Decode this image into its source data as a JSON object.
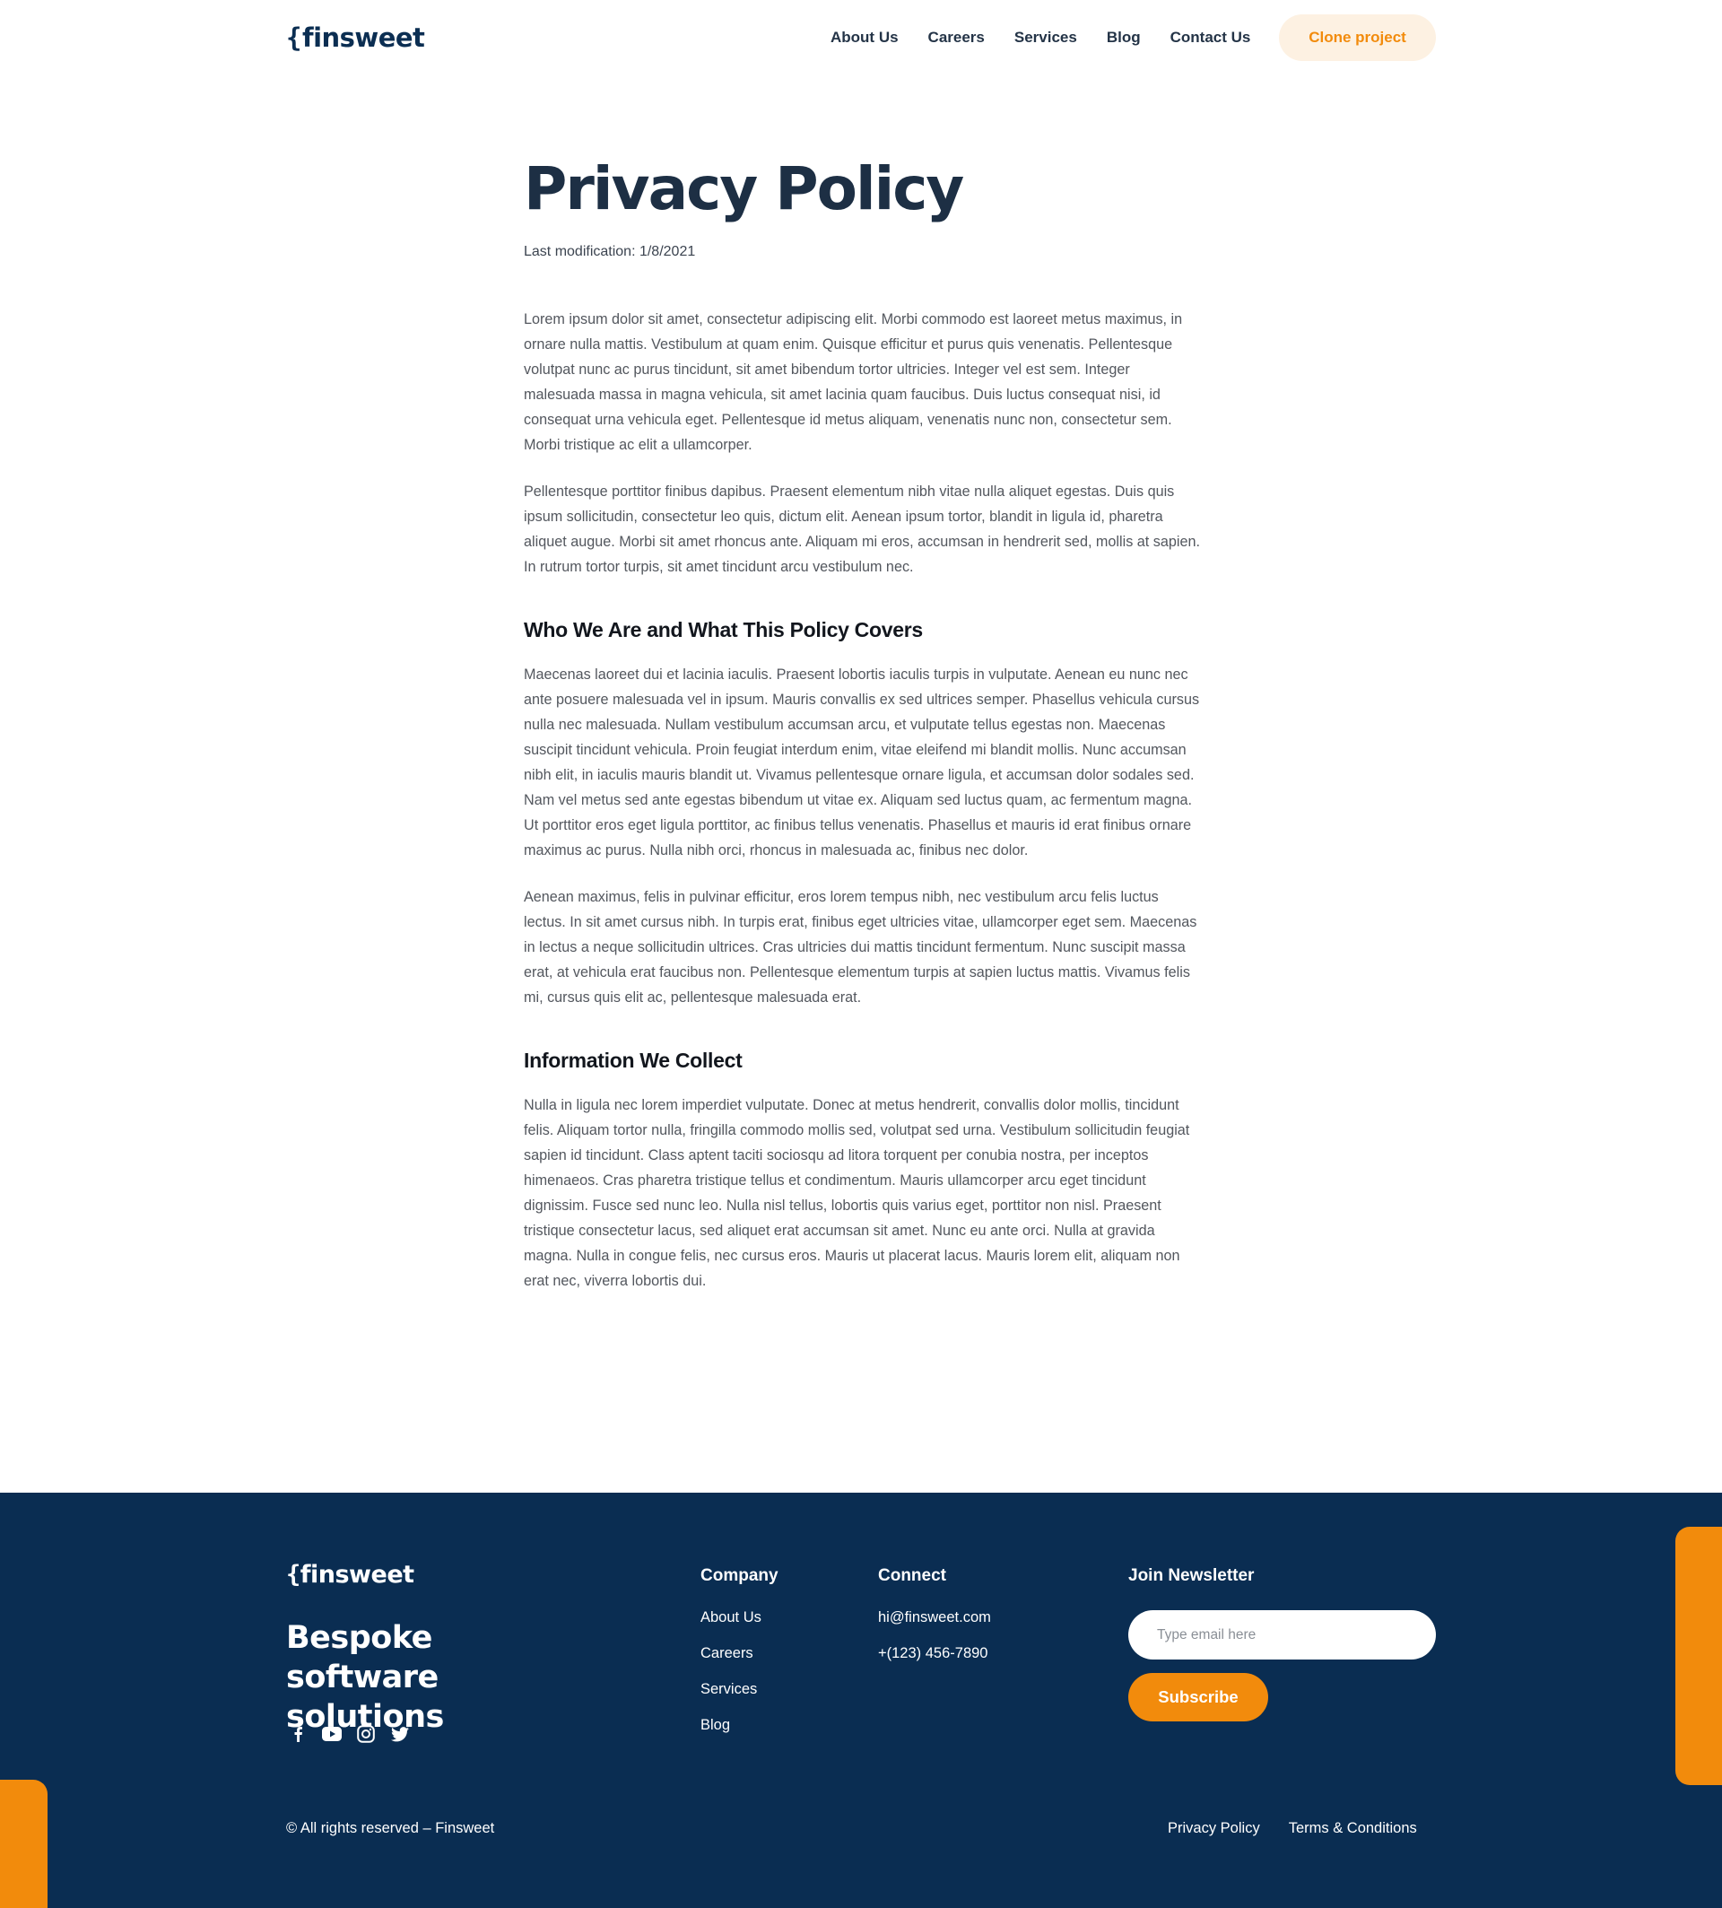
{
  "nav": {
    "logo_brace": "{",
    "logo_text": "finsweet",
    "links": [
      "About Us",
      "Careers",
      "Services",
      "Blog",
      "Contact Us"
    ],
    "cta_label": "Clone project"
  },
  "content": {
    "title": "Privacy Policy",
    "last_modification": "Last modification: 1/8/2021",
    "paragraph_1": "Lorem ipsum dolor sit amet, consectetur adipiscing elit. Morbi commodo est laoreet metus maximus, in ornare nulla mattis. Vestibulum at quam enim. Quisque efficitur et purus quis venenatis. Pellentesque volutpat nunc ac purus tincidunt, sit amet bibendum tortor ultricies. Integer vel est sem. Integer malesuada massa in magna vehicula, sit amet lacinia quam faucibus. Duis luctus consequat nisi, id consequat urna vehicula eget. Pellentesque id metus aliquam, venenatis nunc non, consectetur sem. Morbi tristique ac elit a ullamcorper.",
    "paragraph_2": "Pellentesque porttitor finibus dapibus. Praesent elementum nibh vitae nulla aliquet egestas. Duis quis ipsum sollicitudin, consectetur leo quis, dictum elit. Aenean ipsum tortor, blandit in ligula id, pharetra aliquet augue. Morbi sit amet rhoncus ante. Aliquam mi eros, accumsan in hendrerit sed, mollis at sapien. In rutrum tortor turpis, sit amet tincidunt arcu vestibulum nec.",
    "section_1_heading": "Who We Are and What This Policy Covers",
    "section_1_paragraph_1": "Maecenas laoreet dui et lacinia iaculis. Praesent lobortis iaculis turpis in vulputate. Aenean eu nunc nec ante posuere malesuada vel in ipsum. Mauris convallis ex sed ultrices semper. Phasellus vehicula cursus nulla nec malesuada. Nullam vestibulum accumsan arcu, et vulputate tellus egestas non. Maecenas suscipit tincidunt vehicula. Proin feugiat interdum enim, vitae eleifend mi blandit mollis. Nunc accumsan nibh elit, in iaculis mauris blandit ut. Vivamus pellentesque ornare ligula, et accumsan dolor sodales sed. Nam vel metus sed ante egestas bibendum ut vitae ex. Aliquam sed luctus quam, ac fermentum magna. Ut porttitor eros eget ligula porttitor, ac finibus tellus venenatis. Phasellus et mauris id erat finibus ornare maximus ac purus. Nulla nibh orci, rhoncus in malesuada ac, finibus nec dolor.",
    "section_1_paragraph_2": "Aenean maximus, felis in pulvinar efficitur, eros lorem tempus nibh, nec vestibulum arcu felis luctus lectus. In sit amet cursus nibh. In turpis erat, finibus eget ultricies vitae, ullamcorper eget sem. Maecenas in lectus a neque sollicitudin ultrices. Cras ultricies dui mattis tincidunt fermentum. Nunc suscipit massa erat, at vehicula erat faucibus non. Pellentesque elementum turpis at sapien luctus mattis. Vivamus felis mi, cursus quis elit ac, pellentesque malesuada erat.",
    "section_2_heading": "Information We Collect",
    "section_2_paragraph_1": "Nulla in ligula nec lorem imperdiet vulputate. Donec at metus hendrerit, convallis dolor mollis, tincidunt felis. Aliquam tortor nulla, fringilla commodo mollis sed, volutpat sed urna. Vestibulum sollicitudin feugiat sapien id tincidunt. Class aptent taciti sociosqu ad litora torquent per conubia nostra, per inceptos himenaeos. Cras pharetra tristique tellus et condimentum. Mauris ullamcorper arcu eget tincidunt dignissim. Fusce sed nunc leo. Nulla nisl tellus, lobortis quis varius eget, porttitor non nisl. Praesent tristique consectetur lacus, sed aliquet erat accumsan sit amet. Nunc eu ante orci. Nulla at gravida magna. Nulla in congue felis, nec cursus eros. Mauris ut placerat lacus. Mauris lorem elit, aliquam non erat nec, viverra lobortis dui."
  },
  "footer": {
    "logo_brace": "{",
    "logo_text": "finsweet",
    "tagline": "Bespoke software solutions",
    "socials": [
      "facebook-icon",
      "youtube-icon",
      "instagram-icon",
      "twitter-icon"
    ],
    "company": {
      "title": "Company",
      "links": [
        "About Us",
        "Careers",
        "Services",
        "Blog"
      ]
    },
    "connect": {
      "title": "Connect",
      "email": "hi@finsweet.com",
      "phone": "+(123) 456-7890"
    },
    "newsletter": {
      "title": "Join Newsletter",
      "placeholder": "Type email here",
      "button_label": "Subscribe"
    },
    "copyright": "© All rights reserved – Finsweet",
    "legal_links": [
      "Privacy Policy",
      "Terms & Conditions"
    ]
  },
  "colors": {
    "accent_orange": "#f28b0c",
    "navy": "#0a2d52",
    "cta_bg": "#fdf1e2",
    "heading": "#1d2f44"
  }
}
